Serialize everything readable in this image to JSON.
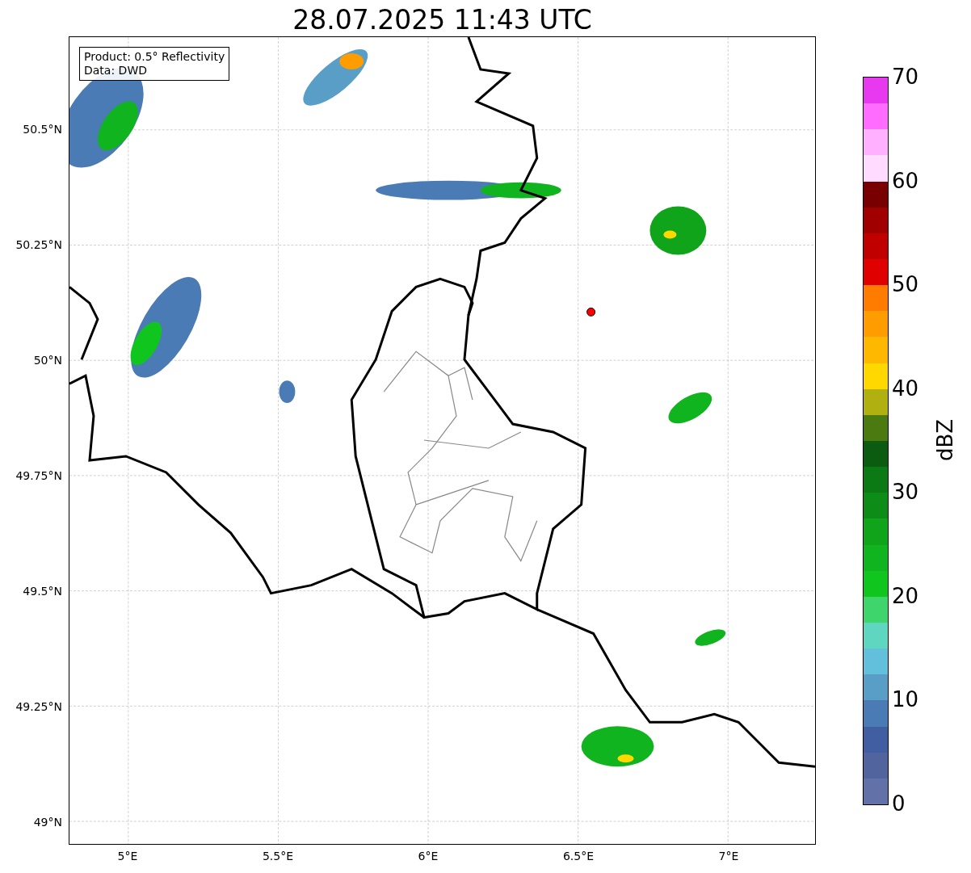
{
  "title": "28.07.2025 11:43 UTC",
  "legend": [
    "Product: 0.5° Reflectivity",
    "Data: DWD"
  ],
  "map": {
    "y_ticks": [
      "50.5°N",
      "50.25°N",
      "50°N",
      "49.75°N",
      "49.5°N",
      "49.25°N",
      "49°N"
    ],
    "x_ticks": [
      "5°E",
      "5.5°E",
      "6°E",
      "6.5°E",
      "7°E"
    ]
  },
  "colorbar": {
    "label": "dBZ",
    "ticks": [
      "70",
      "60",
      "50",
      "40",
      "30",
      "20",
      "10",
      "0"
    ],
    "bands": [
      {
        "color": "#e838f0"
      },
      {
        "color": "#ff6cff"
      },
      {
        "color": "#ffb0ff"
      },
      {
        "color": "#ffdcff"
      },
      {
        "color": "#780000"
      },
      {
        "color": "#a00000"
      },
      {
        "color": "#c00000"
      },
      {
        "color": "#e00000"
      },
      {
        "color": "#ff7c00"
      },
      {
        "color": "#ff9c00"
      },
      {
        "color": "#ffb800"
      },
      {
        "color": "#ffd800"
      },
      {
        "color": "#b0b010"
      },
      {
        "color": "#4a7a10"
      },
      {
        "color": "#0b5c10"
      },
      {
        "color": "#0c7a14"
      },
      {
        "color": "#0e8c18"
      },
      {
        "color": "#10a41a"
      },
      {
        "color": "#10b41e"
      },
      {
        "color": "#10c61e"
      },
      {
        "color": "#3dd56c"
      },
      {
        "color": "#5fd6c0"
      },
      {
        "color": "#63c0dc"
      },
      {
        "color": "#599ec7"
      },
      {
        "color": "#4a7bb4"
      },
      {
        "color": "#425ea3"
      },
      {
        "color": "#52649e"
      },
      {
        "color": "#6272a8"
      }
    ]
  }
}
